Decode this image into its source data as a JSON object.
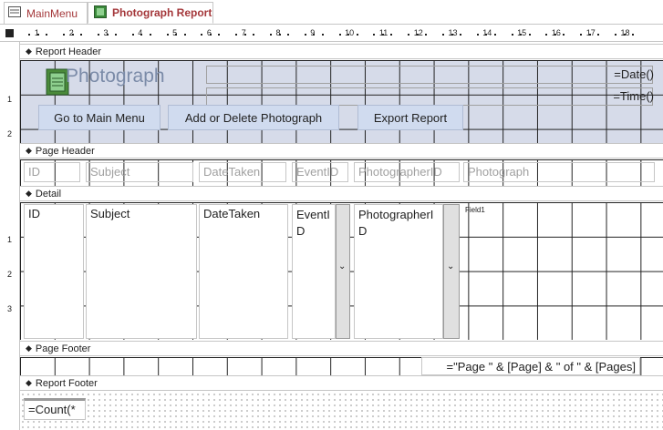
{
  "tabs": [
    {
      "label": "MainMenu",
      "active": false,
      "icon": "form-icon"
    },
    {
      "label": "Photograph Report",
      "active": true,
      "icon": "report-icon"
    }
  ],
  "ruler": {
    "numbers": [
      "1",
      "2",
      "3",
      "4",
      "5",
      "6",
      "7",
      "8",
      "9",
      "10",
      "11",
      "12",
      "13",
      "14",
      "15",
      "16",
      "17",
      "18"
    ]
  },
  "sections": {
    "report_header": "Report Header",
    "page_header": "Page Header",
    "detail": "Detail",
    "page_footer": "Page Footer",
    "report_footer": "Report Footer"
  },
  "report_header": {
    "title": "Photograph",
    "date": "=Date()",
    "time": "=Time()",
    "buttons": {
      "main_menu": "Go to Main Menu",
      "add_delete": "Add or Delete Photograph",
      "export": "Export Report"
    }
  },
  "page_header": {
    "labels": [
      "ID",
      "Subject",
      "DateTaken",
      "EventID",
      "PhotographerID",
      "Photograph"
    ]
  },
  "detail": {
    "fields": [
      "ID",
      "Subject",
      "DateTaken",
      "EventI\nD",
      "PhotographerI\nD"
    ],
    "image_label": "Field1"
  },
  "page_footer": {
    "page_expr": "=\"Page \" & [Page] & \" of \" & [Pages]"
  },
  "report_footer": {
    "count_expr": "=Count(*"
  },
  "colors": {
    "accent": "#a4373a",
    "header_bg": "#d6dbe9",
    "button_bg": "#d0dbef"
  }
}
